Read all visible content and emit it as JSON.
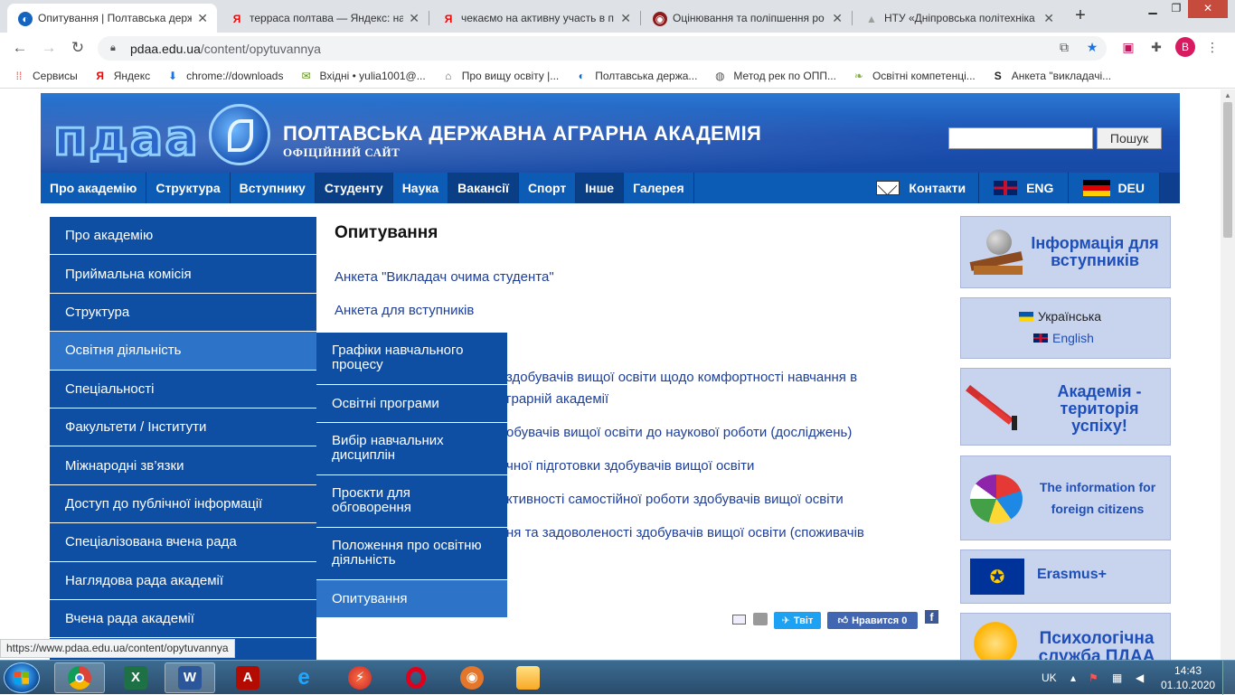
{
  "browser": {
    "tabs": [
      {
        "title": "Опитування | Полтавська держ",
        "active": true,
        "icon_color": "#1565c0",
        "icon_glyph": "◐"
      },
      {
        "title": "терраса полтава — Яндекс: на",
        "active": false,
        "icon_color": "#ff0000",
        "icon_glyph": "Я"
      },
      {
        "title": "чекаємо на активну участь в п",
        "active": false,
        "icon_color": "#ff0000",
        "icon_glyph": "Я"
      },
      {
        "title": "Оцінювання та поліпшення ро",
        "active": false,
        "icon_color": "#8e1b1b",
        "icon_glyph": "◉"
      },
      {
        "title": "НТУ «Дніпровська політехніка",
        "active": false,
        "icon_color": "#9e9e9e",
        "icon_glyph": "▲"
      }
    ],
    "new_tab": "+",
    "url_host": "pdaa.edu.ua",
    "url_path": "/content/opytuvannya",
    "profile_letter": "B",
    "bookmarks": [
      {
        "label": "Сервисы",
        "icon": "apps-grid-icon",
        "glyph": "⁞⁞",
        "color": "#e53935"
      },
      {
        "label": "Яндекс",
        "icon": "yandex-icon",
        "glyph": "Я",
        "color": "#ff0000"
      },
      {
        "label": "chrome://downloads",
        "icon": "download-icon",
        "glyph": "⬇",
        "color": "#1a73e8"
      },
      {
        "label": "Вхідні • yulia1001@...",
        "icon": "mail-icon",
        "glyph": "✉",
        "color": "#5f8f1f"
      },
      {
        "label": "Про вищу освіту |...",
        "icon": "building-icon",
        "glyph": "⌂",
        "color": "#666"
      },
      {
        "label": "Полтавська держа...",
        "icon": "pdaa-icon",
        "glyph": "◐",
        "color": "#1565c0"
      },
      {
        "label": "Метод рек по ОПП...",
        "icon": "globe-icon",
        "glyph": "◍",
        "color": "#555"
      },
      {
        "label": "Освітні компетенці...",
        "icon": "leaf-icon",
        "glyph": "❧",
        "color": "#7cb342"
      },
      {
        "label": "Анкета \"викладачі...",
        "icon": "s-icon",
        "glyph": "S",
        "color": "#222"
      }
    ]
  },
  "site": {
    "logo_text": "пдаа",
    "title": "ПОЛТАВСЬКА ДЕРЖАВНА АГРАРНА АКАДЕМІЯ",
    "subtitle": "ОФІЦІЙНИЙ САЙТ",
    "search_button": "Пошук",
    "nav": [
      {
        "label": "Про академію"
      },
      {
        "label": "Структура"
      },
      {
        "label": "Вступнику"
      },
      {
        "label": "Студенту"
      },
      {
        "label": "Наука"
      },
      {
        "label": "Вакансії"
      },
      {
        "label": "Спорт"
      },
      {
        "label": "Інше"
      },
      {
        "label": "Галерея"
      }
    ],
    "nav_contacts": "Контакти",
    "nav_eng": "ENG",
    "nav_deu": "DEU",
    "side_menu": [
      "Про академію",
      "Приймальна комісія",
      "Структура",
      "Освітня діяльність",
      "Спеціальності",
      "Факультети / Інститути",
      "Міжнародні зв’язки",
      "Доступ до публічної інформації",
      "Спеціалізована вчена рада",
      "Наглядова рада академії",
      "Вчена рада академії"
    ],
    "submenu": [
      "Графіки навчального процесу",
      "Освітні програми",
      "Вибір навчальних дисциплін",
      "Проєкти для обговорення",
      "Положення про освітню діяльність",
      "Опитування"
    ],
    "page_title": "Опитування",
    "links": [
      "Анкета \"Викладач очима студента\"",
      "Анкета для вступників",
      "здобувачів вищої освіти щодо комфортності навчання в",
      "грарній академії",
      "обувачів вищої освіти до наукової роботи (досліджень)",
      "чної підготовки здобувачів вищої освіти",
      "ктивності самостійної роботи здобувачів вищої освіти",
      "ня та задоволеності здобувачів вищої освіти (споживачів"
    ],
    "share_tweet": "Твіт",
    "share_like": "Нравится 0",
    "share_fb": "f",
    "right": {
      "info_applicants": "Інформація для вступників",
      "lang_uk": "Українська",
      "lang_en": "English",
      "success": "Академія - територія успіху!",
      "foreign": "The information for foreign citizens",
      "erasmus": "Erasmus+",
      "psych": "Психологічна служба ПДАА"
    }
  },
  "status_url": "https://www.pdaa.edu.ua/content/opytuvannya",
  "taskbar": {
    "lang": "UK",
    "time": "14:43",
    "date": "01.10.2020"
  }
}
